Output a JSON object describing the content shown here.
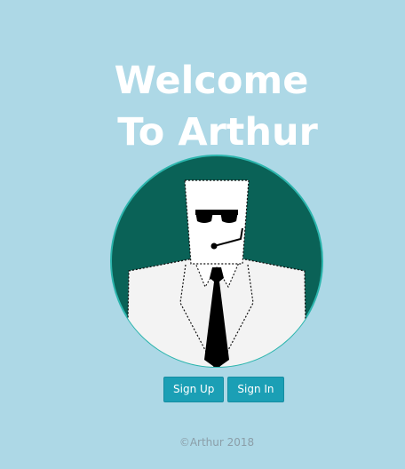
{
  "header": {
    "title_line1": "Welcome",
    "title_line2": "To Arthur"
  },
  "avatar": {
    "icon": "agent-in-suit-icon",
    "colors": {
      "circle_fill": "#0a6257",
      "circle_border": "#2cb5ad",
      "suit": "#f3f3f3",
      "tie": "#000000",
      "sunglasses": "#000000"
    }
  },
  "actions": {
    "sign_up_label": "Sign Up",
    "sign_in_label": "Sign In",
    "accent_color": "#1b9fb5"
  },
  "footer": {
    "copyright": "©Arthur 2018"
  }
}
